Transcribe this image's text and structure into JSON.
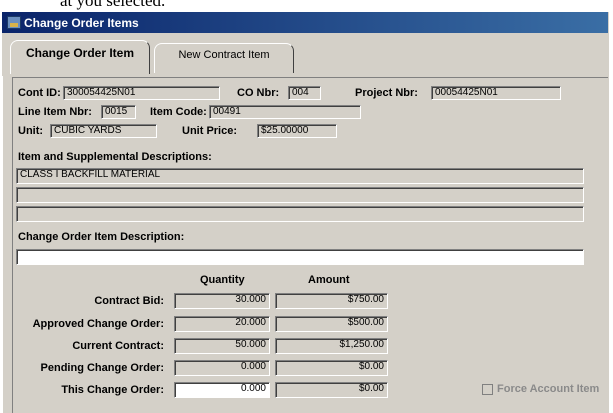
{
  "caption_fragment": "at you selected.",
  "window": {
    "title": "Change Order Items"
  },
  "tabs": [
    {
      "label": "Change Order Item"
    },
    {
      "label": "New Contract Item"
    }
  ],
  "header_fields": {
    "cont_id": {
      "label": "Cont ID:",
      "value": "300054425N01"
    },
    "co_nbr": {
      "label": "CO Nbr:",
      "value": "004"
    },
    "project_nbr": {
      "label": "Project Nbr:",
      "value": "00054425N01"
    },
    "line_item_nbr": {
      "label": "Line Item Nbr:",
      "value": "0015"
    },
    "item_code": {
      "label": "Item Code:",
      "value": "00491"
    },
    "unit": {
      "label": "Unit:",
      "value": "CUBIC YARDS"
    },
    "unit_price": {
      "label": "Unit Price:",
      "value": "$25.00000"
    }
  },
  "descriptions": {
    "label": "Item and Supplemental Descriptions:",
    "lines": [
      "CLASS I BACKFILL MATERIAL",
      "",
      ""
    ]
  },
  "co_description": {
    "label": "Change Order Item Description:",
    "value": ""
  },
  "grid": {
    "col_quantity": "Quantity",
    "col_amount": "Amount",
    "rows": [
      {
        "label": "Contract Bid:",
        "quantity": "30.000",
        "amount": "$750.00"
      },
      {
        "label": "Approved Change Order:",
        "quantity": "20.000",
        "amount": "$500.00"
      },
      {
        "label": "Current Contract:",
        "quantity": "50.000",
        "amount": "$1,250.00"
      },
      {
        "label": "Pending Change Order:",
        "quantity": "0.000",
        "amount": "$0.00"
      },
      {
        "label": "This Change Order:",
        "quantity": "0.000",
        "amount": "$0.00"
      }
    ]
  },
  "force_account": {
    "label": "Force Account Item",
    "checked": false
  }
}
